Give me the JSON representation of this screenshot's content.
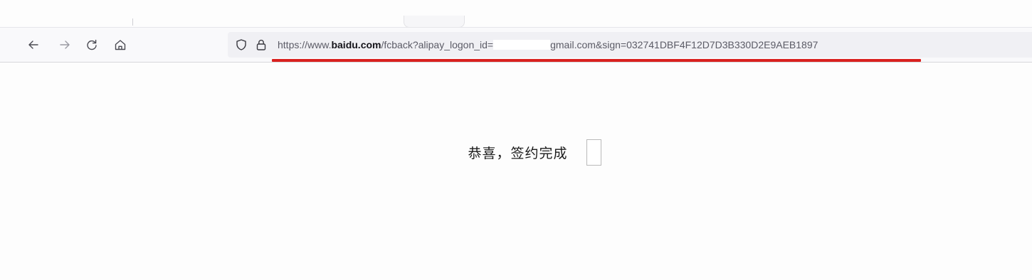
{
  "toolbar": {
    "url_prefix": "https://www.",
    "url_domain": "baidu.com",
    "url_path_before_redaction": "/fcback?alipay_logon_id=",
    "url_path_after_redaction": "gmail.com&sign=032741DBF4F12D7D3B330D2E9AEB1897",
    "underline_color": "#d9211f",
    "icons": [
      "back-arrow-icon",
      "forward-arrow-icon",
      "reload-icon",
      "home-icon",
      "shield-icon",
      "lock-icon"
    ]
  },
  "content": {
    "message": "恭喜，签约完成"
  }
}
